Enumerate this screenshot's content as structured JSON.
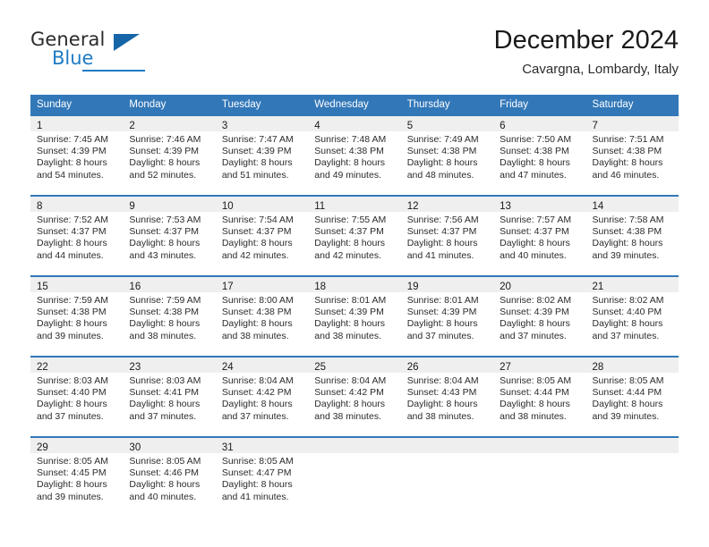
{
  "brand": {
    "name_part1": "General",
    "name_part2": "Blue",
    "accent_color": "#1f7bc4",
    "triangle_color": "#1565a8"
  },
  "header": {
    "title": "December 2024",
    "subtitle": "Cavargna, Lombardy, Italy"
  },
  "theme": {
    "header_row_color": "#3277b8",
    "day_band_color": "#efefef",
    "text_color": "#2b2b2b"
  },
  "weekday_headers": [
    "Sunday",
    "Monday",
    "Tuesday",
    "Wednesday",
    "Thursday",
    "Friday",
    "Saturday"
  ],
  "weeks": [
    [
      {
        "day": "1",
        "sunrise": "Sunrise: 7:45 AM",
        "sunset": "Sunset: 4:39 PM",
        "daylight_line1": "Daylight: 8 hours",
        "daylight_line2": "and 54 minutes."
      },
      {
        "day": "2",
        "sunrise": "Sunrise: 7:46 AM",
        "sunset": "Sunset: 4:39 PM",
        "daylight_line1": "Daylight: 8 hours",
        "daylight_line2": "and 52 minutes."
      },
      {
        "day": "3",
        "sunrise": "Sunrise: 7:47 AM",
        "sunset": "Sunset: 4:39 PM",
        "daylight_line1": "Daylight: 8 hours",
        "daylight_line2": "and 51 minutes."
      },
      {
        "day": "4",
        "sunrise": "Sunrise: 7:48 AM",
        "sunset": "Sunset: 4:38 PM",
        "daylight_line1": "Daylight: 8 hours",
        "daylight_line2": "and 49 minutes."
      },
      {
        "day": "5",
        "sunrise": "Sunrise: 7:49 AM",
        "sunset": "Sunset: 4:38 PM",
        "daylight_line1": "Daylight: 8 hours",
        "daylight_line2": "and 48 minutes."
      },
      {
        "day": "6",
        "sunrise": "Sunrise: 7:50 AM",
        "sunset": "Sunset: 4:38 PM",
        "daylight_line1": "Daylight: 8 hours",
        "daylight_line2": "and 47 minutes."
      },
      {
        "day": "7",
        "sunrise": "Sunrise: 7:51 AM",
        "sunset": "Sunset: 4:38 PM",
        "daylight_line1": "Daylight: 8 hours",
        "daylight_line2": "and 46 minutes."
      }
    ],
    [
      {
        "day": "8",
        "sunrise": "Sunrise: 7:52 AM",
        "sunset": "Sunset: 4:37 PM",
        "daylight_line1": "Daylight: 8 hours",
        "daylight_line2": "and 44 minutes."
      },
      {
        "day": "9",
        "sunrise": "Sunrise: 7:53 AM",
        "sunset": "Sunset: 4:37 PM",
        "daylight_line1": "Daylight: 8 hours",
        "daylight_line2": "and 43 minutes."
      },
      {
        "day": "10",
        "sunrise": "Sunrise: 7:54 AM",
        "sunset": "Sunset: 4:37 PM",
        "daylight_line1": "Daylight: 8 hours",
        "daylight_line2": "and 42 minutes."
      },
      {
        "day": "11",
        "sunrise": "Sunrise: 7:55 AM",
        "sunset": "Sunset: 4:37 PM",
        "daylight_line1": "Daylight: 8 hours",
        "daylight_line2": "and 42 minutes."
      },
      {
        "day": "12",
        "sunrise": "Sunrise: 7:56 AM",
        "sunset": "Sunset: 4:37 PM",
        "daylight_line1": "Daylight: 8 hours",
        "daylight_line2": "and 41 minutes."
      },
      {
        "day": "13",
        "sunrise": "Sunrise: 7:57 AM",
        "sunset": "Sunset: 4:37 PM",
        "daylight_line1": "Daylight: 8 hours",
        "daylight_line2": "and 40 minutes."
      },
      {
        "day": "14",
        "sunrise": "Sunrise: 7:58 AM",
        "sunset": "Sunset: 4:38 PM",
        "daylight_line1": "Daylight: 8 hours",
        "daylight_line2": "and 39 minutes."
      }
    ],
    [
      {
        "day": "15",
        "sunrise": "Sunrise: 7:59 AM",
        "sunset": "Sunset: 4:38 PM",
        "daylight_line1": "Daylight: 8 hours",
        "daylight_line2": "and 39 minutes."
      },
      {
        "day": "16",
        "sunrise": "Sunrise: 7:59 AM",
        "sunset": "Sunset: 4:38 PM",
        "daylight_line1": "Daylight: 8 hours",
        "daylight_line2": "and 38 minutes."
      },
      {
        "day": "17",
        "sunrise": "Sunrise: 8:00 AM",
        "sunset": "Sunset: 4:38 PM",
        "daylight_line1": "Daylight: 8 hours",
        "daylight_line2": "and 38 minutes."
      },
      {
        "day": "18",
        "sunrise": "Sunrise: 8:01 AM",
        "sunset": "Sunset: 4:39 PM",
        "daylight_line1": "Daylight: 8 hours",
        "daylight_line2": "and 38 minutes."
      },
      {
        "day": "19",
        "sunrise": "Sunrise: 8:01 AM",
        "sunset": "Sunset: 4:39 PM",
        "daylight_line1": "Daylight: 8 hours",
        "daylight_line2": "and 37 minutes."
      },
      {
        "day": "20",
        "sunrise": "Sunrise: 8:02 AM",
        "sunset": "Sunset: 4:39 PM",
        "daylight_line1": "Daylight: 8 hours",
        "daylight_line2": "and 37 minutes."
      },
      {
        "day": "21",
        "sunrise": "Sunrise: 8:02 AM",
        "sunset": "Sunset: 4:40 PM",
        "daylight_line1": "Daylight: 8 hours",
        "daylight_line2": "and 37 minutes."
      }
    ],
    [
      {
        "day": "22",
        "sunrise": "Sunrise: 8:03 AM",
        "sunset": "Sunset: 4:40 PM",
        "daylight_line1": "Daylight: 8 hours",
        "daylight_line2": "and 37 minutes."
      },
      {
        "day": "23",
        "sunrise": "Sunrise: 8:03 AM",
        "sunset": "Sunset: 4:41 PM",
        "daylight_line1": "Daylight: 8 hours",
        "daylight_line2": "and 37 minutes."
      },
      {
        "day": "24",
        "sunrise": "Sunrise: 8:04 AM",
        "sunset": "Sunset: 4:42 PM",
        "daylight_line1": "Daylight: 8 hours",
        "daylight_line2": "and 37 minutes."
      },
      {
        "day": "25",
        "sunrise": "Sunrise: 8:04 AM",
        "sunset": "Sunset: 4:42 PM",
        "daylight_line1": "Daylight: 8 hours",
        "daylight_line2": "and 38 minutes."
      },
      {
        "day": "26",
        "sunrise": "Sunrise: 8:04 AM",
        "sunset": "Sunset: 4:43 PM",
        "daylight_line1": "Daylight: 8 hours",
        "daylight_line2": "and 38 minutes."
      },
      {
        "day": "27",
        "sunrise": "Sunrise: 8:05 AM",
        "sunset": "Sunset: 4:44 PM",
        "daylight_line1": "Daylight: 8 hours",
        "daylight_line2": "and 38 minutes."
      },
      {
        "day": "28",
        "sunrise": "Sunrise: 8:05 AM",
        "sunset": "Sunset: 4:44 PM",
        "daylight_line1": "Daylight: 8 hours",
        "daylight_line2": "and 39 minutes."
      }
    ],
    [
      {
        "day": "29",
        "sunrise": "Sunrise: 8:05 AM",
        "sunset": "Sunset: 4:45 PM",
        "daylight_line1": "Daylight: 8 hours",
        "daylight_line2": "and 39 minutes."
      },
      {
        "day": "30",
        "sunrise": "Sunrise: 8:05 AM",
        "sunset": "Sunset: 4:46 PM",
        "daylight_line1": "Daylight: 8 hours",
        "daylight_line2": "and 40 minutes."
      },
      {
        "day": "31",
        "sunrise": "Sunrise: 8:05 AM",
        "sunset": "Sunset: 4:47 PM",
        "daylight_line1": "Daylight: 8 hours",
        "daylight_line2": "and 41 minutes."
      },
      {
        "day": "",
        "sunrise": "",
        "sunset": "",
        "daylight_line1": "",
        "daylight_line2": ""
      },
      {
        "day": "",
        "sunrise": "",
        "sunset": "",
        "daylight_line1": "",
        "daylight_line2": ""
      },
      {
        "day": "",
        "sunrise": "",
        "sunset": "",
        "daylight_line1": "",
        "daylight_line2": ""
      },
      {
        "day": "",
        "sunrise": "",
        "sunset": "",
        "daylight_line1": "",
        "daylight_line2": ""
      }
    ]
  ]
}
